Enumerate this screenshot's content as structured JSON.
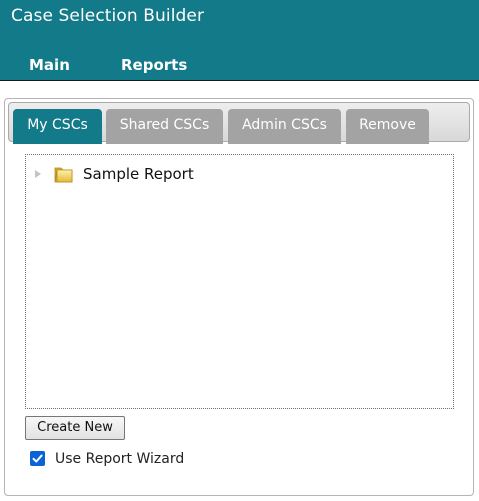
{
  "app": {
    "title": "Case Selection Builder"
  },
  "nav": {
    "main_label": "Main",
    "reports_label": "Reports"
  },
  "tabs": [
    {
      "label": "My CSCs",
      "active": true
    },
    {
      "label": "Shared CSCs",
      "active": false
    },
    {
      "label": "Admin CSCs",
      "active": false
    },
    {
      "label": "Remove",
      "active": false
    }
  ],
  "tree": {
    "items": [
      {
        "label": "Sample Report",
        "icon": "folder-icon",
        "expanded": false
      }
    ]
  },
  "actions": {
    "create_label": "Create New"
  },
  "options": {
    "wizard_label": "Use Report Wizard",
    "wizard_checked": true
  },
  "colors": {
    "header": "#127a88",
    "active_tab": "#127a88",
    "inactive_tab": "#a3a3a3",
    "checkbox": "#0a64d8"
  }
}
